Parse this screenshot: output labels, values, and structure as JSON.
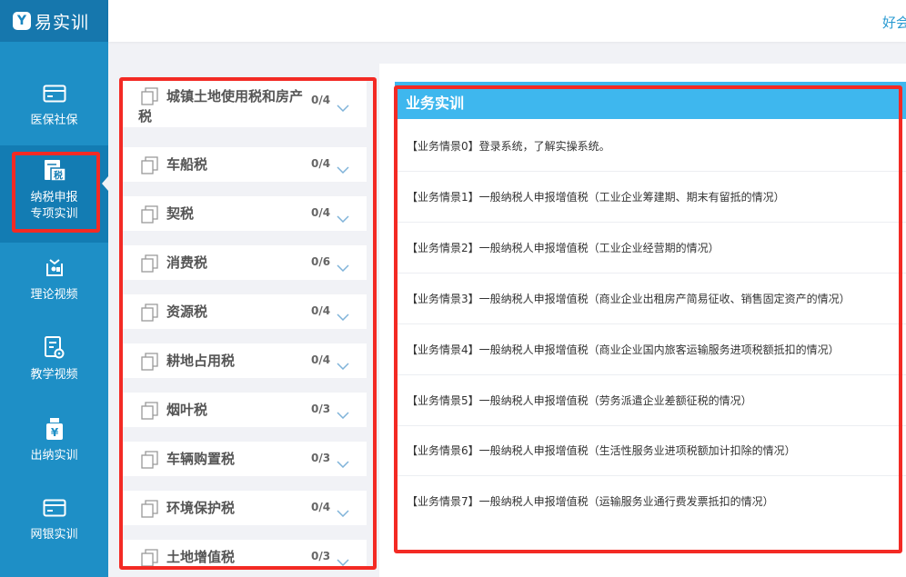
{
  "app": {
    "name": "易实训",
    "logo_mark": "Y"
  },
  "header": {
    "user_text": "好会"
  },
  "sidebar": {
    "items": [
      {
        "label": "医保社保",
        "icon": "card-icon"
      },
      {
        "label": "纳税申报\n专项实训",
        "icon": "tax-icon",
        "icon_text": "税",
        "active": true
      },
      {
        "label": "理论视频",
        "icon": "video-book-icon"
      },
      {
        "label": "教学视频",
        "icon": "document-gear-icon"
      },
      {
        "label": "出纳实训",
        "icon": "yen-bag-icon",
        "icon_text": "¥"
      },
      {
        "label": "网银实训",
        "icon": "card-icon"
      }
    ]
  },
  "tax_list": [
    {
      "name_line1": "城镇土地使用税和房产",
      "name_line2": "税",
      "count": "0/4"
    },
    {
      "name": "车船税",
      "count": "0/4"
    },
    {
      "name": "契税",
      "count": "0/4"
    },
    {
      "name": "消费税",
      "count": "0/6"
    },
    {
      "name": "资源税",
      "count": "0/4"
    },
    {
      "name": "耕地占用税",
      "count": "0/4"
    },
    {
      "name": "烟叶税",
      "count": "0/3"
    },
    {
      "name": "车辆购置税",
      "count": "0/3"
    },
    {
      "name": "环境保护税",
      "count": "0/4"
    },
    {
      "name": "土地增值税",
      "count": "0/3"
    }
  ],
  "panel": {
    "title": "业务实训",
    "scenarios": [
      "【业务情景0】登录系统，了解实操系统。",
      "【业务情景1】一般纳税人申报增值税（工业企业筹建期、期末有留抵的情况）",
      "【业务情景2】一般纳税人申报增值税（工业企业经营期的情况）",
      "【业务情景3】一般纳税人申报增值税（商业企业出租房产简易征收、销售固定资产的情况）",
      "【业务情景4】一般纳税人申报增值税（商业企业国内旅客运输服务进项税额抵扣的情况）",
      "【业务情景5】一般纳税人申报增值税（劳务派遣企业差额征税的情况）",
      "【业务情景6】一般纳税人申报增值税（生活性服务业进项税额加计扣除的情况）",
      "【业务情景7】一般纳税人申报增值税（运输服务业通行费发票抵扣的情况）"
    ]
  },
  "colors": {
    "sidebar": "#1e8fc6",
    "accent": "#3eb7ee",
    "highlight": "#f32a24"
  }
}
